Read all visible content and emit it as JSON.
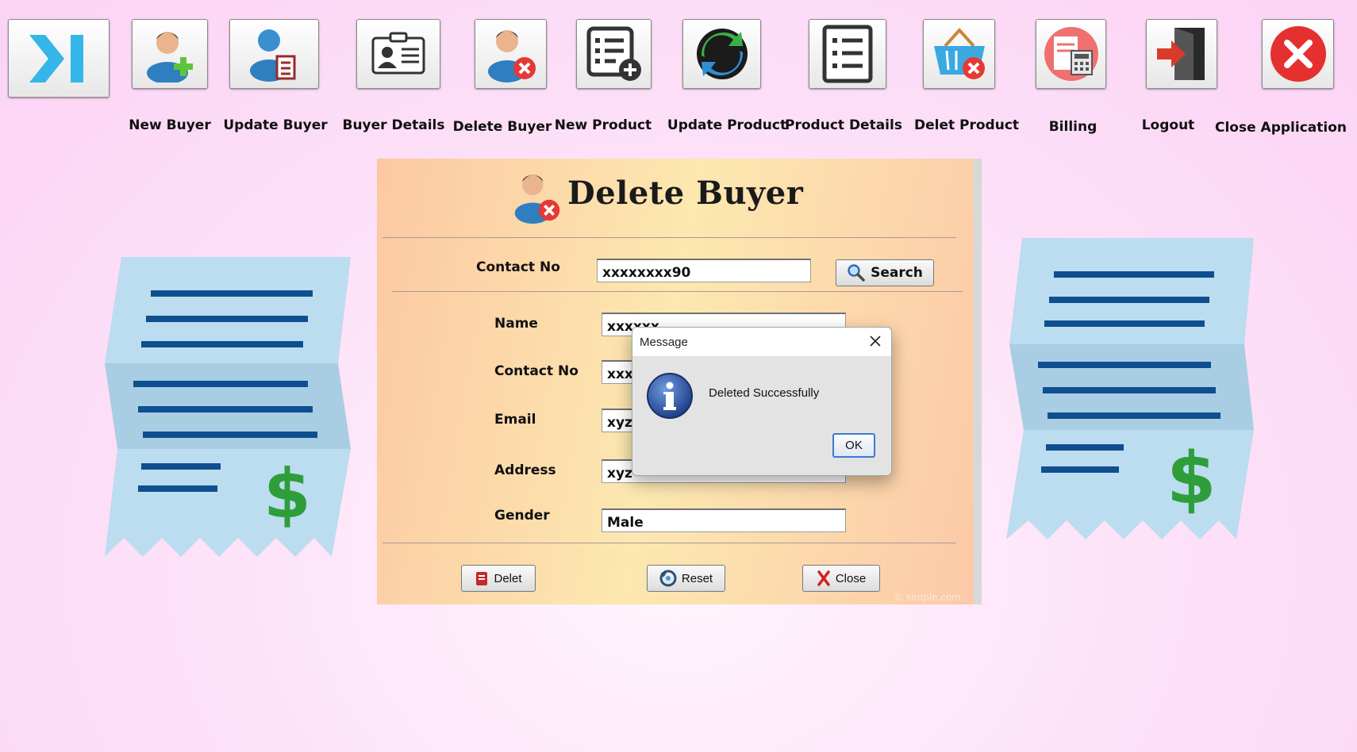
{
  "toolbar": {
    "items": [
      {
        "label": ""
      },
      {
        "label": "New Buyer"
      },
      {
        "label": "Update Buyer"
      },
      {
        "label": "Buyer Details"
      },
      {
        "label": "Delete Buyer"
      },
      {
        "label": "New Product"
      },
      {
        "label": "Update Product"
      },
      {
        "label": "Product Details"
      },
      {
        "label": "Delet Product"
      },
      {
        "label": "Billing"
      },
      {
        "label": "Logout"
      },
      {
        "label": "Close Application"
      }
    ]
  },
  "form": {
    "title": "Delete Buyer",
    "search": {
      "label": "Contact No",
      "value": "xxxxxxxx90",
      "button_label": "Search"
    },
    "fields": {
      "name": {
        "label": "Name",
        "value": "xxxxxx"
      },
      "contact": {
        "label": "Contact No",
        "value": "xxx"
      },
      "email": {
        "label": "Email",
        "value": "xyz"
      },
      "address": {
        "label": "Address",
        "value": "xyz"
      },
      "gender": {
        "label": "Gender",
        "value": "Male"
      }
    },
    "buttons": {
      "delete": "Delet",
      "reset": "Reset",
      "close": "Close"
    },
    "watermark": "© simple.com"
  },
  "dialog": {
    "title": "Message",
    "message": "Deleted Successfully",
    "ok_label": "OK"
  },
  "colors": {
    "background": "#fbd6f5",
    "panel_left": "#fcc8a2",
    "panel_mid": "#fce8b0",
    "receipt_light": "#bcdcef",
    "receipt_dark": "#a9cde3",
    "receipt_lines": "#0e4f8f",
    "dollar_green": "#2e9e3a",
    "close_red": "#e02020",
    "info_blue": "#2b4f9c"
  }
}
